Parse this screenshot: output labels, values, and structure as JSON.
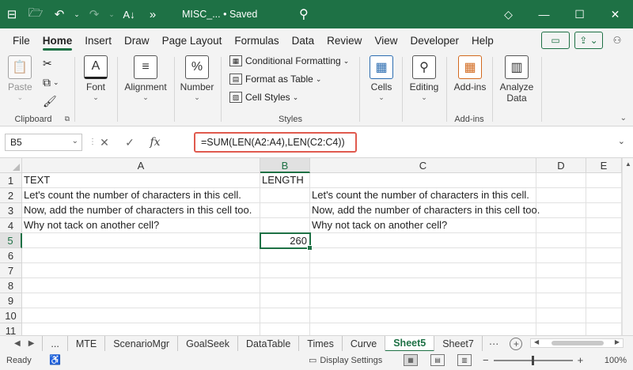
{
  "titlebar": {
    "doc_title": "MISC_... • Saved",
    "save_icon": "floppy-icon",
    "colors": {
      "brand": "#1e7145"
    }
  },
  "tabs": [
    "File",
    "Home",
    "Insert",
    "Draw",
    "Page Layout",
    "Formulas",
    "Data",
    "Review",
    "View",
    "Developer",
    "Help"
  ],
  "active_tab": "Home",
  "ribbon": {
    "paste_label": "Paste",
    "clipboard_label": "Clipboard",
    "font_label": "Font",
    "alignment_label": "Alignment",
    "number_label": "Number",
    "conditional_formatting": "Conditional Formatting",
    "format_as_table": "Format as Table",
    "cell_styles": "Cell Styles",
    "styles_label": "Styles",
    "cells_label": "Cells",
    "editing_label": "Editing",
    "addins_btn_label": "Add-ins",
    "addins_group_label": "Add-ins",
    "analyze_label_1": "Analyze",
    "analyze_label_2": "Data"
  },
  "formula_bar": {
    "name_box": "B5",
    "cancel_glyph": "✕",
    "enter_glyph": "✓",
    "fx": "fx",
    "formula": "=SUM(LEN(A2:A4),LEN(C2:C4))"
  },
  "columns": [
    "A",
    "B",
    "C",
    "D",
    "E"
  ],
  "rows": [
    "1",
    "2",
    "3",
    "4",
    "5",
    "6",
    "7",
    "8",
    "9",
    "10",
    "11"
  ],
  "cells": {
    "A1": "TEXT",
    "B1": "LENGTH",
    "A2": "Let's count the number of characters in this cell.",
    "A3": "Now, add the number of characters in this cell too.",
    "A4": "Why not tack on another cell?",
    "C2": "Let's count the number of characters in this cell.",
    "C3": "Now, add the number of characters in this cell too.",
    "C4": "Why not tack on another cell?",
    "B5": "260"
  },
  "sheet_tabs": [
    "MTE",
    "ScenarioMgr",
    "GoalSeek",
    "DataTable",
    "Times",
    "Curve",
    "Sheet5",
    "Sheet7"
  ],
  "active_sheet": "Sheet5",
  "sheet_overflow": "...",
  "status": {
    "ready": "Ready",
    "display_settings": "Display Settings",
    "zoom_pct": "100%"
  }
}
